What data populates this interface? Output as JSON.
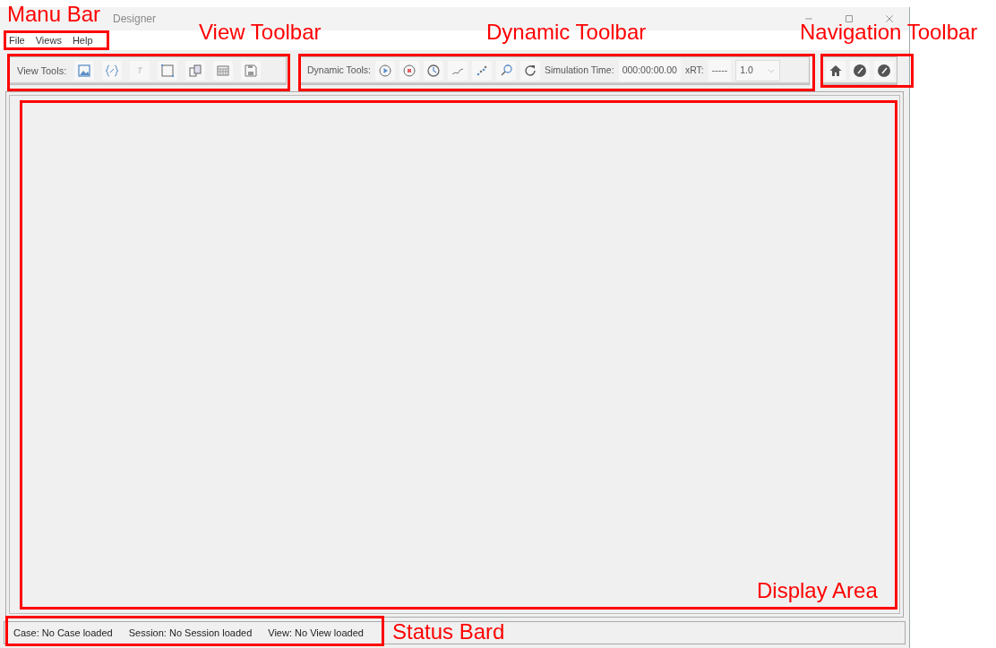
{
  "window": {
    "title": "Designer"
  },
  "menu": [
    "File",
    "Views",
    "Help"
  ],
  "view_toolbar": {
    "label": "View Tools:"
  },
  "dynamic_toolbar": {
    "label": "Dynamic Tools:",
    "simulation_time_label": "Simulation Time:",
    "simulation_time": "000:00:00.00",
    "xrt_label": "xRT:",
    "xrt": "-----",
    "speed": "1.0"
  },
  "status_bar": [
    "Case: No Case loaded",
    "Session: No Session loaded",
    "View: No View loaded"
  ],
  "annotations": [
    {
      "label": "Manu Bar"
    },
    {
      "label": "View Toolbar"
    },
    {
      "label": "Dynamic Toolbar"
    },
    {
      "label": "Navigation Toolbar"
    },
    {
      "label": "Display Area"
    },
    {
      "label": "Status Bard"
    }
  ]
}
